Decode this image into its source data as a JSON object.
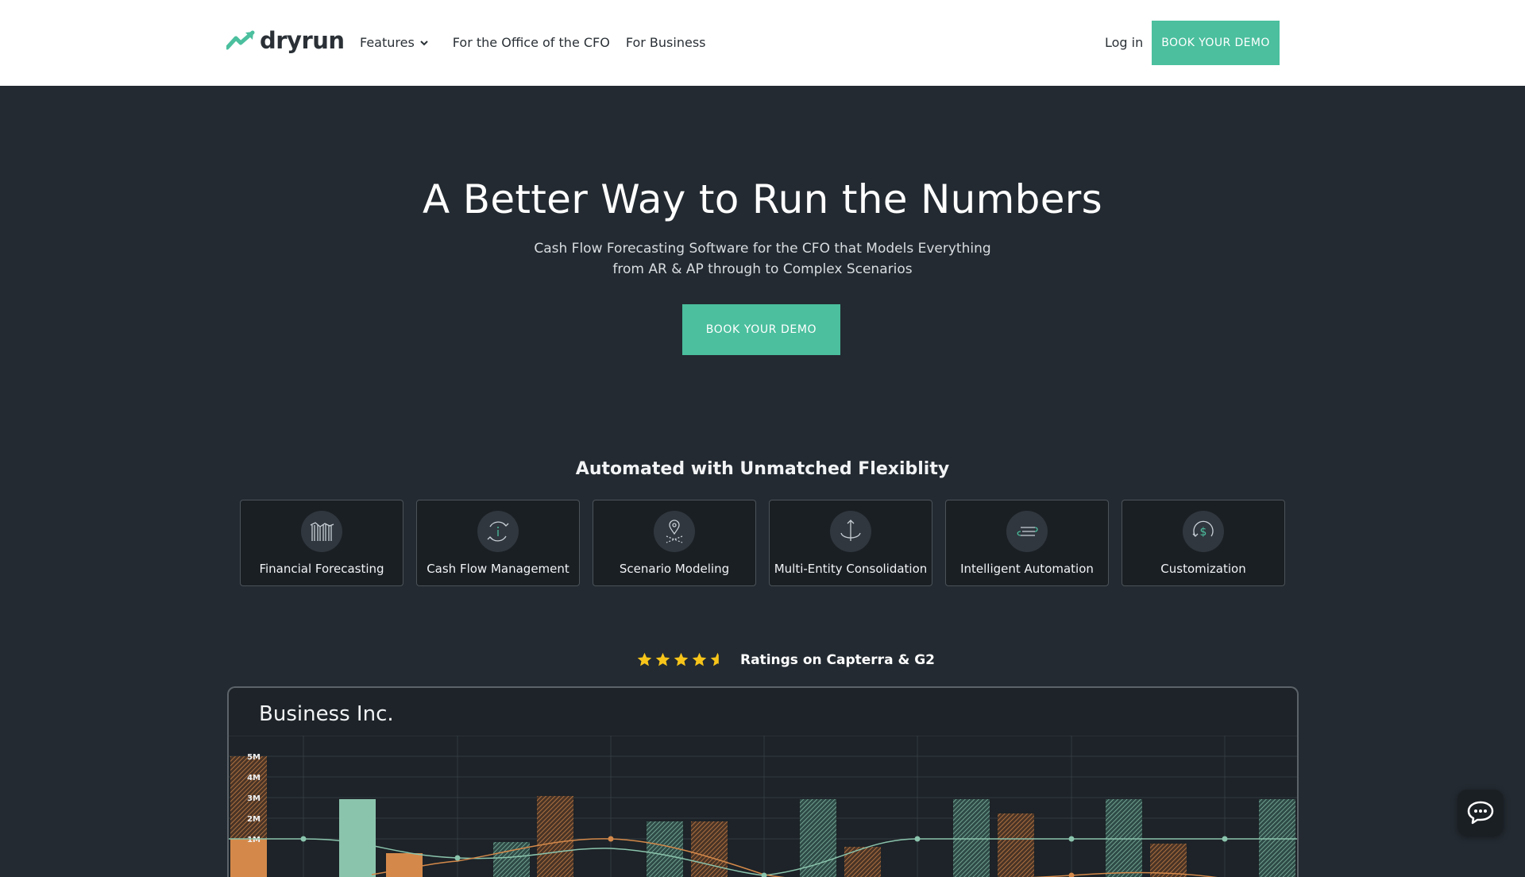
{
  "header": {
    "logo_text": "dryrun",
    "nav": [
      {
        "label": "Features"
      },
      {
        "label": "For the Office of the CFO"
      },
      {
        "label": "For Business"
      }
    ],
    "login": "Log in",
    "cta": "BOOK YOUR DEMO"
  },
  "hero": {
    "title": "A Better Way to Run the Numbers",
    "subtitle": "Cash Flow Forecasting Software for the CFO that Models Everything from AR & AP through to Complex Scenarios",
    "cta": "BOOK YOUR DEMO"
  },
  "features": {
    "heading": "Automated with Unmatched Flexiblity",
    "items": [
      {
        "label": "Financial Forecasting",
        "icon": "chart-columns-icon"
      },
      {
        "label": "Cash Flow Management",
        "icon": "cycle-info-icon"
      },
      {
        "label": "Scenario Modeling",
        "icon": "map-pin-icon"
      },
      {
        "label": "Multi-Entity Consolidation",
        "icon": "merge-arrow-icon"
      },
      {
        "label": "Intelligent Automation",
        "icon": "list-icon"
      },
      {
        "label": "Customization",
        "icon": "dollar-cycle-icon"
      }
    ]
  },
  "ratings": {
    "stars": 4.5,
    "text": "Ratings on Capterra & G2"
  },
  "dashboard": {
    "title": "Business Inc.",
    "chart_data": {
      "type": "bar",
      "y_ticks": [
        "5M",
        "4M",
        "3M",
        "2M",
        "1M"
      ],
      "ylim": [
        0,
        5
      ],
      "colors": {
        "teal": "#8bc4ad",
        "orange": "#d4894a"
      }
    }
  },
  "colors": {
    "accent": "#4bbf9e",
    "background": "#232a31",
    "header": "#ffffff",
    "star": "#f7c51a"
  }
}
